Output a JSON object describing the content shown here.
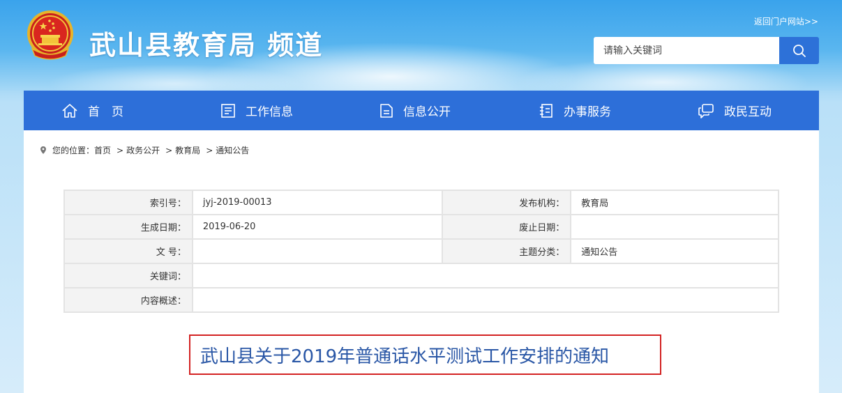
{
  "header": {
    "site_title": "武山县教育局 频道",
    "portal_link": "返回门户网站>>",
    "emblem_icon": "national-emblem-icon"
  },
  "search": {
    "placeholder": "请输入关键词",
    "button_icon": "search-icon"
  },
  "nav": {
    "items": [
      {
        "label": "首　页",
        "icon": "home-icon"
      },
      {
        "label": "工作信息",
        "icon": "list-document-icon"
      },
      {
        "label": "信息公开",
        "icon": "document-icon"
      },
      {
        "label": "办事服务",
        "icon": "notebook-icon"
      },
      {
        "label": "政民互动",
        "icon": "chat-icon"
      }
    ]
  },
  "breadcrumb": {
    "prefix": "您的位置：",
    "items": [
      "首页",
      "政务公开",
      "教育局",
      "通知公告"
    ]
  },
  "meta_table": {
    "index_label": "索引号：",
    "index_value": "jyj-2019-00013",
    "publisher_label": "发布机构：",
    "publisher_value": "教育局",
    "created_label": "生成日期：",
    "created_value": "2019-06-20",
    "expire_label": "废止日期：",
    "expire_value": "",
    "docno_label": "文 号：",
    "docno_value": "",
    "topic_label": "主题分类：",
    "topic_value": "通知公告",
    "keyword_label": "关键词：",
    "keyword_value": "",
    "summary_label": "内容概述：",
    "summary_value": ""
  },
  "article": {
    "title": "武山县关于2019年普通话水平测试工作安排的通知"
  },
  "colors": {
    "nav_bg": "#2d6fd9",
    "title_text": "#2a57a6",
    "title_border": "#d32222"
  }
}
